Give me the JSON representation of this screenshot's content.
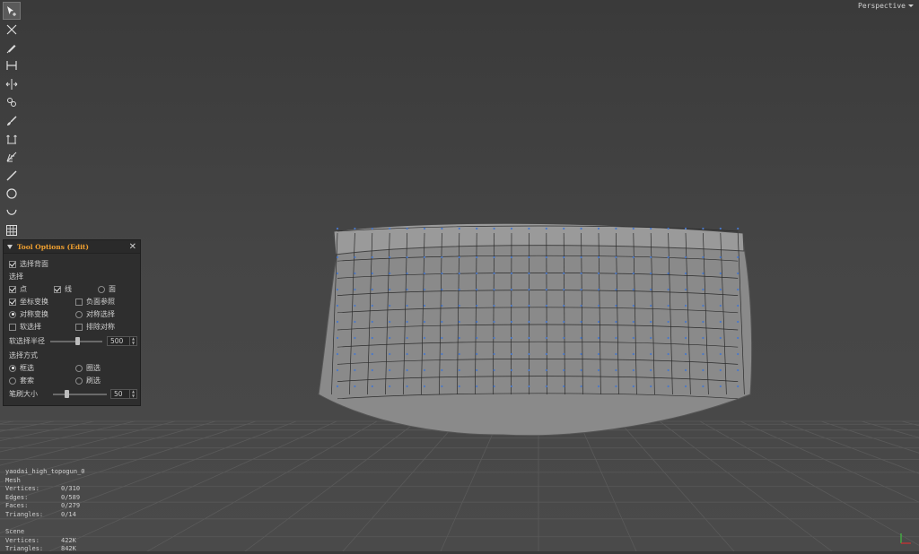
{
  "viewport": {
    "camera_label": "Perspective"
  },
  "toolbar": {
    "tools": [
      {
        "icon": "select-arrow-icon",
        "active": true
      },
      {
        "icon": "cross-arrows-icon",
        "active": false
      },
      {
        "icon": "pen-icon",
        "active": false
      },
      {
        "icon": "bridge-icon",
        "active": false
      },
      {
        "icon": "split-arrows-icon",
        "active": false
      },
      {
        "icon": "chain-icon",
        "active": false
      },
      {
        "icon": "brush-icon",
        "active": false
      },
      {
        "icon": "extrude-icon",
        "active": false
      },
      {
        "icon": "cone-icon",
        "active": false
      },
      {
        "icon": "knife-icon",
        "active": false
      },
      {
        "icon": "circle-icon",
        "active": false
      },
      {
        "icon": "curve-icon",
        "active": false
      },
      {
        "icon": "grid-icon",
        "active": false
      }
    ]
  },
  "tool_options": {
    "title": "Tool Options (Edit)",
    "select_back": "选择背面",
    "select_heading": "选择",
    "point": "点",
    "line": "线",
    "face": "面",
    "coord_transform": "坐标变换",
    "negative_ref": "负面参照",
    "symmetric_transform": "对称变换",
    "symmetric_select": "对称选择",
    "soft_select": "软选择",
    "exclude_symmetry": "排除对称",
    "soft_radius_label": "软选择半径",
    "soft_radius_value": "500",
    "select_mode_heading": "选择方式",
    "box_select": "框选",
    "lasso_select": "圈选",
    "set_select": "套索",
    "paint_select": "刷选",
    "brush_size_label": "笔刷大小",
    "brush_size_value": "50"
  },
  "stats": {
    "object_name": "yaodai_high_topogun_0",
    "type": "Mesh",
    "vertices_label": "Vertices:",
    "vertices": "0/310",
    "edges_label": "Edges:",
    "edges": "0/589",
    "faces_label": "Faces:",
    "faces": "0/279",
    "triangles_label": "Triangles:",
    "triangles": "0/14",
    "scene_label": "Scene",
    "scene_vertices": "422K",
    "scene_triangles": "842K"
  }
}
